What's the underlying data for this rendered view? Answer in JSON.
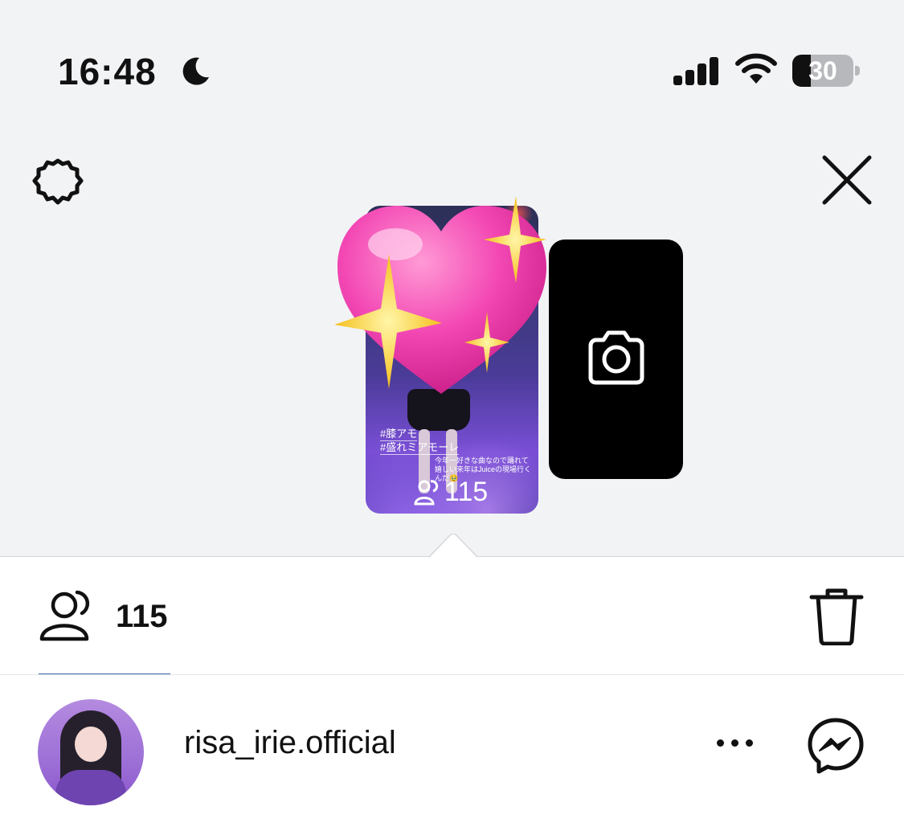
{
  "status_bar": {
    "time": "16:48",
    "focus_icon": "moon-icon",
    "battery_level": "30",
    "battery_fraction": 0.3
  },
  "header": {
    "left_icon": "gear-icon",
    "right_icon": "close-icon"
  },
  "story": {
    "hashtags": [
      "#膝アモ",
      "#盛れミアモーレ"
    ],
    "caption": "今年一好きな曲なので踊れて嬉しい来年はJuiceの現場行くんだ🥹",
    "viewer_count": "115"
  },
  "camera_card": {
    "icon": "camera-icon"
  },
  "viewers_panel": {
    "viewer_count": "115",
    "viewers_icon": "viewers-icon",
    "delete_icon": "trash-icon"
  },
  "viewers": [
    {
      "username": "risa_irie.official"
    }
  ],
  "colors": {
    "background": "#f2f3f5",
    "sheet": "#ffffff",
    "tab_underline": "#3a68b6"
  }
}
